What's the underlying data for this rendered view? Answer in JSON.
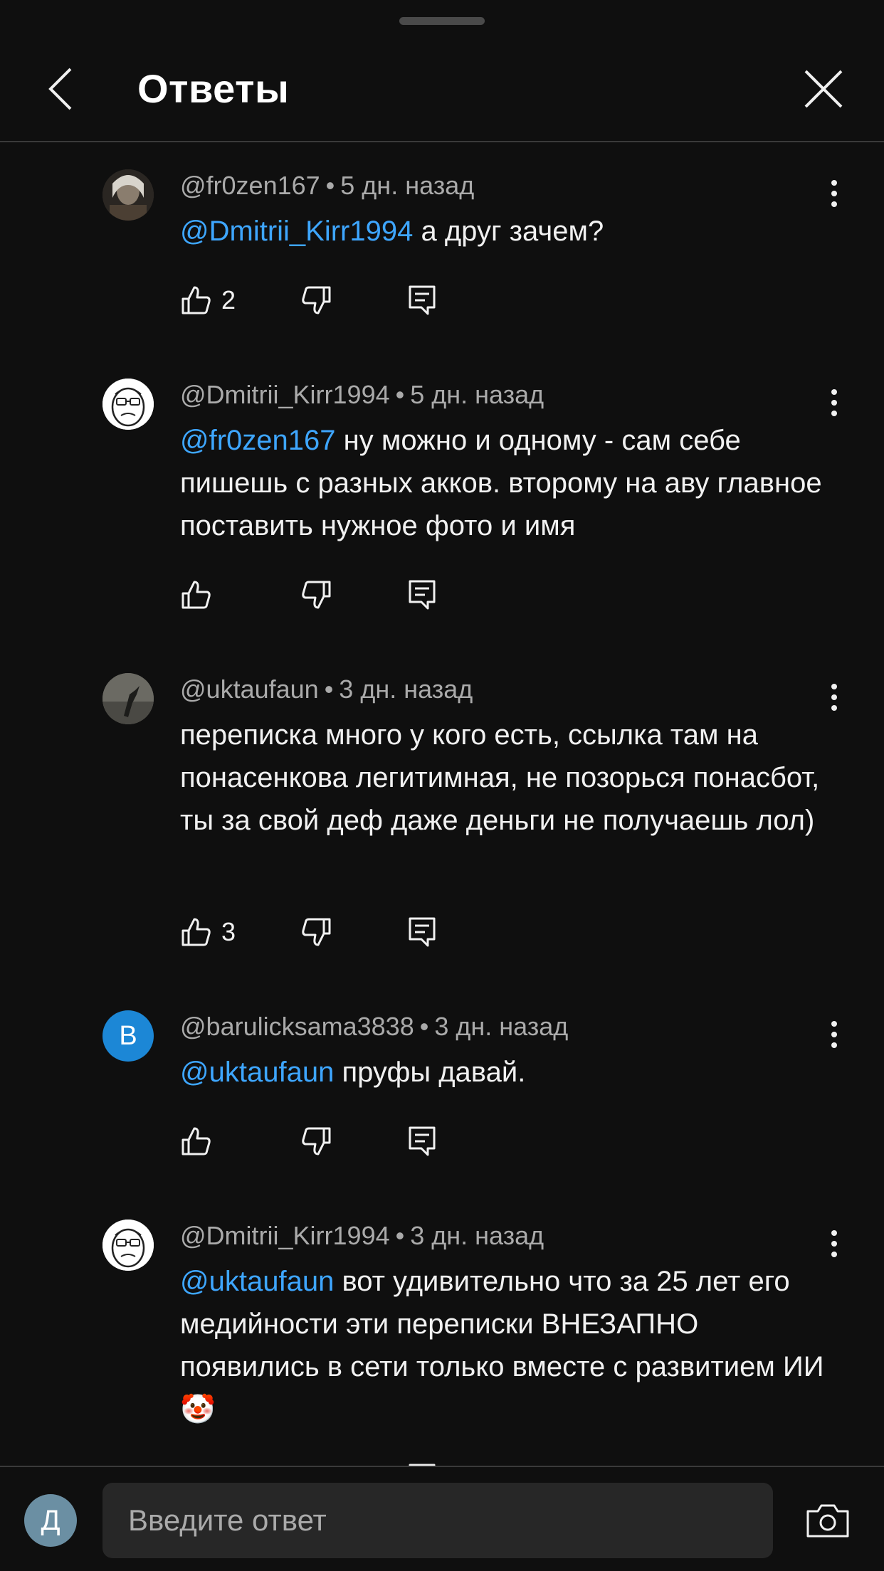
{
  "header": {
    "title": "Ответы",
    "back_icon": "chevron-left-icon",
    "close_icon": "close-icon"
  },
  "comments": [
    {
      "author": "@fr0zen167",
      "time": "5 дн. назад",
      "mention": "@Dmitrii_Kirr1994",
      "text": "а друг зачем?",
      "likes": "2",
      "avatar_kind": "photo-witcher"
    },
    {
      "author": "@Dmitrii_Kirr1994",
      "time": "5 дн. назад",
      "mention": "@fr0zen167",
      "text": "ну можно и одному - сам себе пишешь с разных акков. второму на аву главное поставить нужное фото и имя",
      "likes": "",
      "avatar_kind": "drawing-face"
    },
    {
      "author": "@uktaufaun",
      "time": "3 дн. назад",
      "mention": "",
      "text": "переписка много у кого есть, ссылка там на понасенкова легитимная, не позорься понасбот, ты за свой деф даже деньги не получаешь лол)",
      "likes": "3",
      "avatar_kind": "photo-dark"
    },
    {
      "author": "@barulicksama3838",
      "time": "3 дн. назад",
      "mention": "@uktaufaun",
      "text": "пруфы давай.",
      "likes": "",
      "avatar_kind": "letter",
      "avatar_letter": "B",
      "avatar_color": "#1c87d6"
    },
    {
      "author": "@Dmitrii_Kirr1994",
      "time": "3 дн. назад",
      "mention": "@uktaufaun",
      "text": "вот удивительно что за 25 лет его медийности эти переписки ВНЕЗАПНО появились в сети только вместе с развитием ИИ 🤡",
      "likes": "",
      "avatar_kind": "drawing-face"
    }
  ],
  "footer": {
    "user_initial": "Д",
    "reply_placeholder": "Введите ответ",
    "camera_icon": "camera-icon"
  },
  "colors": {
    "background": "#0f0f0f",
    "mention": "#3ea6ff",
    "meta": "#aaaaaa",
    "input_bg": "#272727"
  }
}
